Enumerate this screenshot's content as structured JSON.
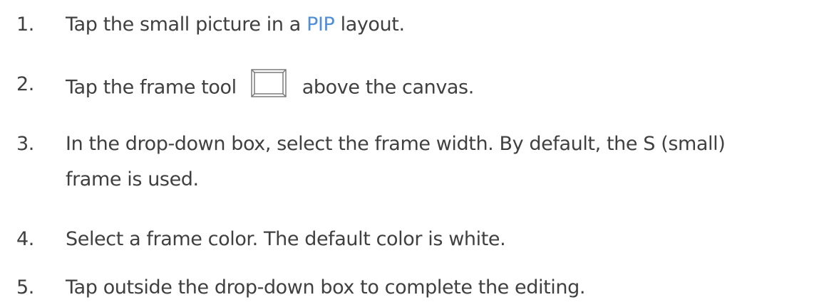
{
  "steps": [
    {
      "number": "1.",
      "before": "Tap the small picture in a ",
      "link": "PIP",
      "after": " layout."
    },
    {
      "number": "2.",
      "before": "Tap the frame tool",
      "icon": "frame-tool-icon",
      "after": "above the canvas."
    },
    {
      "number": "3.",
      "line1": "In the drop-down box, select the frame width. By default, the S (small)",
      "line2": "frame is used."
    },
    {
      "number": "4.",
      "text": "Select a frame color. The default color is white."
    },
    {
      "number": "5.",
      "text": "Tap outside the drop-down box to complete the editing."
    }
  ],
  "colors": {
    "text": "#404040",
    "link": "#4f8fd8"
  }
}
